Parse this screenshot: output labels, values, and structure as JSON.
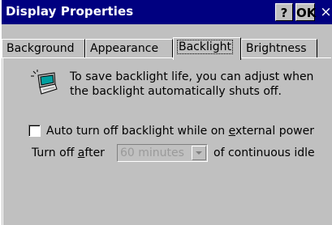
{
  "window": {
    "title": "Display Properties",
    "help_label": "?",
    "ok_label": "OK",
    "close_label": "×"
  },
  "tabs": [
    {
      "label": "Background"
    },
    {
      "label": "Appearance"
    },
    {
      "label": "Backlight",
      "active": true
    },
    {
      "label": "Brightness"
    }
  ],
  "backlight": {
    "description": "To save backlight life, you can adjust when the backlight automatically shuts off.",
    "icon": "laptop-sun-icon",
    "auto_off": {
      "checked": false,
      "label_prefix": "Auto turn off backlight while on ",
      "label_mnemonic": "e",
      "label_suffix": "xternal power"
    },
    "turn_off": {
      "label_prefix": "Turn off ",
      "label_mnemonic": "a",
      "label_suffix": "fter",
      "selected": "60 minutes",
      "after_text": "of continuous idle"
    }
  }
}
